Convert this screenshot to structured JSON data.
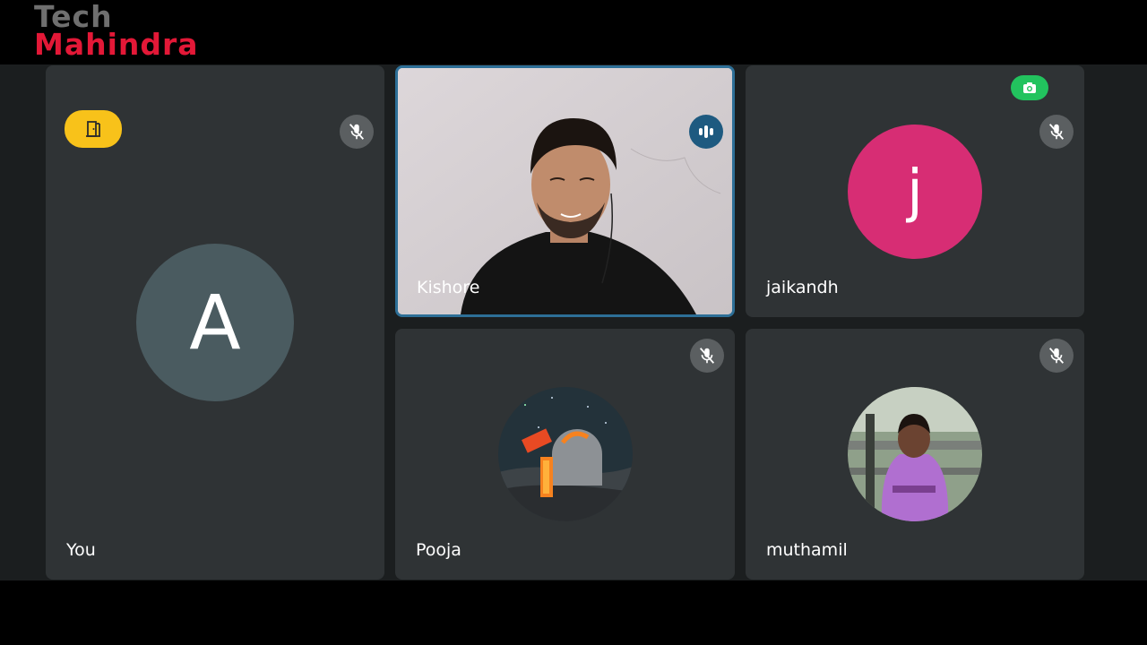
{
  "brand": {
    "line1": "Tech",
    "line2": "Mahindra"
  },
  "participants": [
    {
      "name": "You",
      "avatar_letter": "A",
      "avatar_color": "#4a5b60",
      "muted": true,
      "badge": "door-icon"
    },
    {
      "name": "Kishore",
      "speaking": true,
      "active_border": "#2d6f97"
    },
    {
      "name": "jaikandh",
      "avatar_letter": "j",
      "avatar_color": "#d72d74",
      "muted": true,
      "badge": "camera-icon"
    },
    {
      "name": "Pooja",
      "muted": true
    },
    {
      "name": "muthamil",
      "muted": true
    }
  ]
}
